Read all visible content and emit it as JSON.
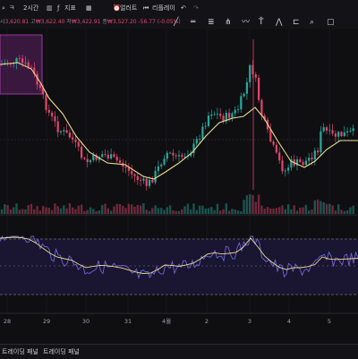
{
  "toolbar": {
    "ticker": "ㅋ",
    "timeframe": "2시간",
    "indicators_label": "지표",
    "alert_label": "얼러트",
    "replay_label": "리플레이",
    "undo_icon": "undo-icon"
  },
  "ohlc": {
    "open": "3,620.81",
    "high": "₩3,622.40",
    "low": "₩3,422.91",
    "close": "₩3,527.20",
    "change": "-56.77 (-0.05%)"
  },
  "drawing_tools": [
    "line-tool-icon",
    "horizontal-line-icon",
    "fib-icon",
    "pitchfork-icon",
    "brush-icon",
    "text-icon",
    "pattern-icon",
    "measure-icon",
    "zoom-icon",
    "more-icon"
  ],
  "x_axis_labels": [
    "28",
    "29",
    "30",
    "31",
    "4월",
    "2",
    "3",
    "4",
    "5"
  ],
  "bottom_bar": {
    "left_label": "트레이딩 패널",
    "right_label": "트레이딩 패널"
  },
  "colors": {
    "up": "#2aa79b",
    "down": "#e2466a",
    "ma": "#e8dc8e",
    "rsi": "#6e66d6",
    "rsi_ma": "#e8dc8e",
    "highlight": "#9a2fa1"
  }
}
